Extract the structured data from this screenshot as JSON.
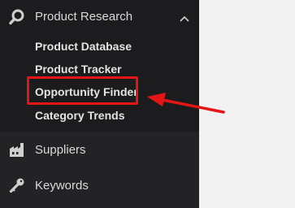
{
  "sidebar": {
    "section": {
      "label": "Product Research",
      "icon": "magnifier-icon",
      "expanded": true,
      "items": [
        {
          "label": "Product Database"
        },
        {
          "label": "Product Tracker"
        },
        {
          "label": "Opportunity Finder",
          "highlighted": true
        },
        {
          "label": "Category Trends"
        }
      ]
    },
    "nav": [
      {
        "label": "Suppliers",
        "icon": "factory-icon"
      },
      {
        "label": "Keywords",
        "icon": "key-icon"
      }
    ]
  },
  "annotation": {
    "color": "#e31515"
  }
}
